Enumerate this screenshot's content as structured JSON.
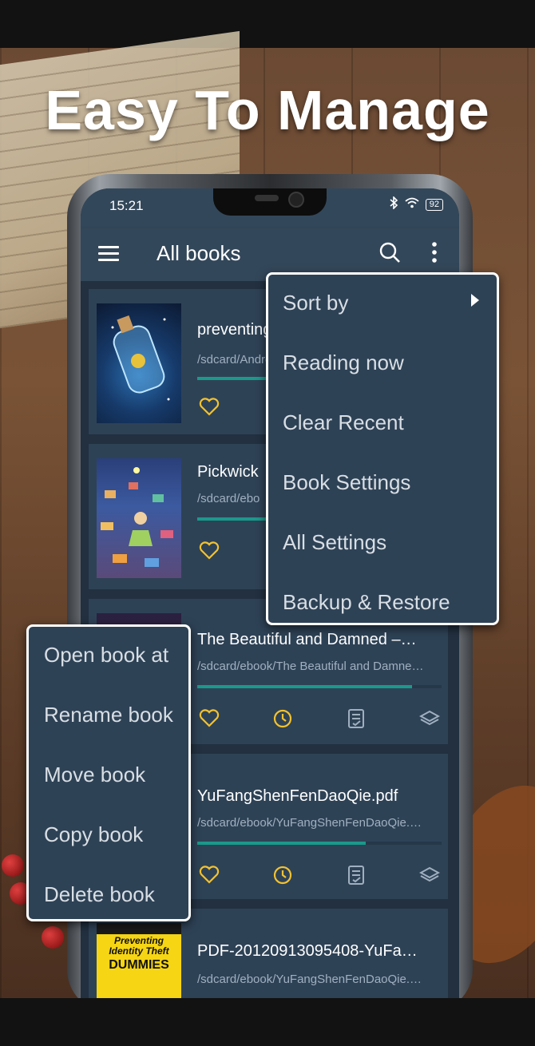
{
  "headline": "Easy To Manage",
  "status_bar": {
    "time": "15:21",
    "battery": "92"
  },
  "app_bar": {
    "title": "All books"
  },
  "books": [
    {
      "title": "preventing",
      "path": "/sdcard/Andro",
      "progress": 0.3
    },
    {
      "title": "Pickwick",
      "path": "/sdcard/ebo",
      "progress": 0.3
    },
    {
      "title": "The Beautiful and Damned –…",
      "path": "/sdcard/ebook/The Beautiful and Damne…",
      "progress": 0.88
    },
    {
      "title": "YuFangShenFenDaoQie.pdf",
      "path": "/sdcard/ebook/YuFangShenFenDaoQie.…",
      "progress": 0.69
    },
    {
      "title": "PDF-20120913095408-YuFa…",
      "path": "/sdcard/ebook/YuFangShenFenDaoQie.…"
    }
  ],
  "cover_text": {
    "line1": "Preventing",
    "line2": "Identity Theft",
    "line3": "DUMMIES"
  },
  "overflow_menu": {
    "items": [
      "Sort by",
      "Reading now",
      "Clear Recent",
      "Book Settings",
      "All Settings",
      "Backup & Restore"
    ]
  },
  "book_menu": {
    "items": [
      "Open book at",
      "Rename book",
      "Move book",
      "Copy book",
      "Delete book"
    ]
  },
  "colors": {
    "accent": "#1b998b",
    "icon": "#f2c230",
    "toolbar": "#33475a",
    "card": "#2e4256"
  },
  "icons": [
    "menu-icon",
    "search-icon",
    "more-vert-icon",
    "heart-icon",
    "clock-icon",
    "notes-icon",
    "layers-icon",
    "chevron-right-icon"
  ]
}
